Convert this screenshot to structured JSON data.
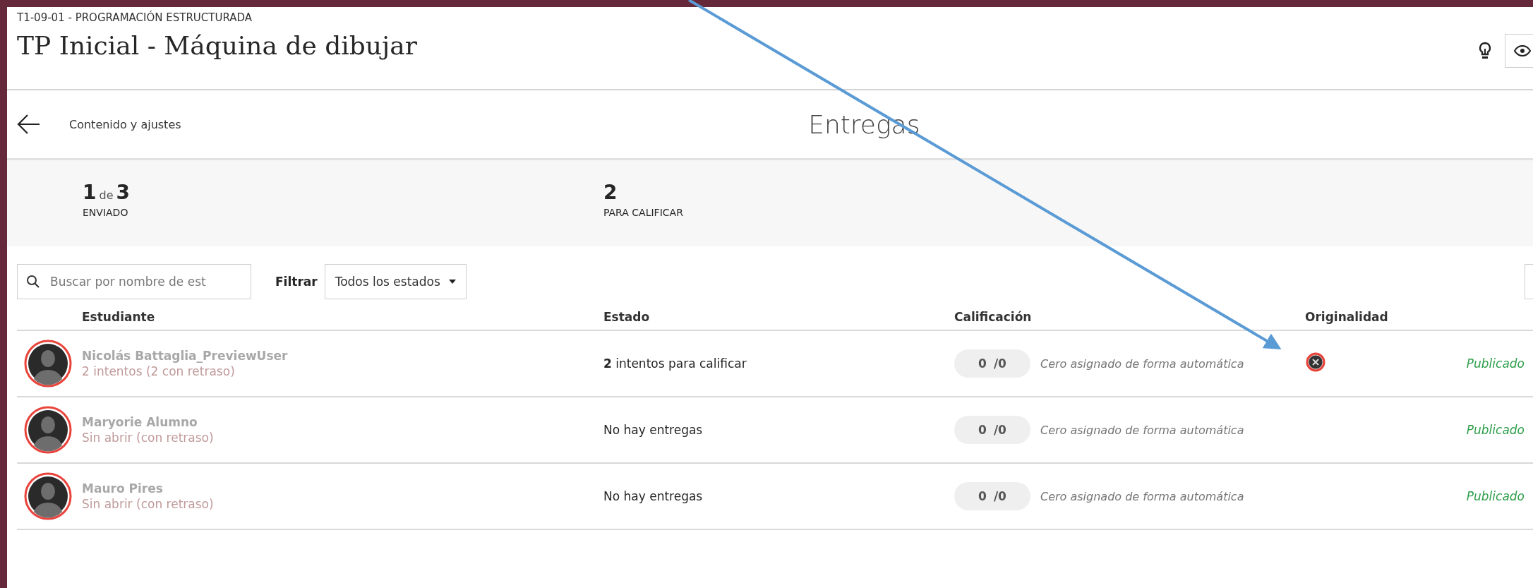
{
  "header": {
    "course": "T1-09-01 - PROGRAMACIÓN ESTRUCTURADA",
    "title": "TP Inicial - Máquina de dibujar"
  },
  "nav": {
    "back_label": "Contenido y ajustes",
    "title": "Entregas"
  },
  "stats": [
    {
      "value": "1",
      "joiner": "de",
      "total": "3",
      "label": "ENVIADO"
    },
    {
      "value": "2",
      "label": "PARA CALIFICAR"
    }
  ],
  "search": {
    "placeholder": "Buscar por nombre de est"
  },
  "filter": {
    "label": "Filtrar",
    "value": "Todos los estados"
  },
  "table": {
    "columns": [
      "Estudiante",
      "Estado",
      "Calificación",
      "Originalidad"
    ],
    "rows": [
      {
        "name": "Nicolás Battaglia_PreviewUser",
        "detail": "2 intentos (2 con retraso)",
        "status": "**2** intentos para calificar",
        "grade": "0",
        "max": "/0",
        "grade_note": "Cero asignado de forma automática",
        "originality_flag": true,
        "publish": "Publicado"
      },
      {
        "name": "Maryorie Alumno",
        "detail": "Sin abrir (con retraso)",
        "status": "No hay entregas",
        "grade": "0",
        "max": "/0",
        "grade_note": "Cero asignado de forma automática",
        "originality_flag": false,
        "publish": "Publicado"
      },
      {
        "name": "Mauro Pires",
        "detail": "Sin abrir (con retraso)",
        "status": "No hay entregas",
        "grade": "0",
        "max": "/0",
        "grade_note": "Cero asignado de forma automática",
        "originality_flag": false,
        "publish": "Publicado"
      }
    ]
  }
}
